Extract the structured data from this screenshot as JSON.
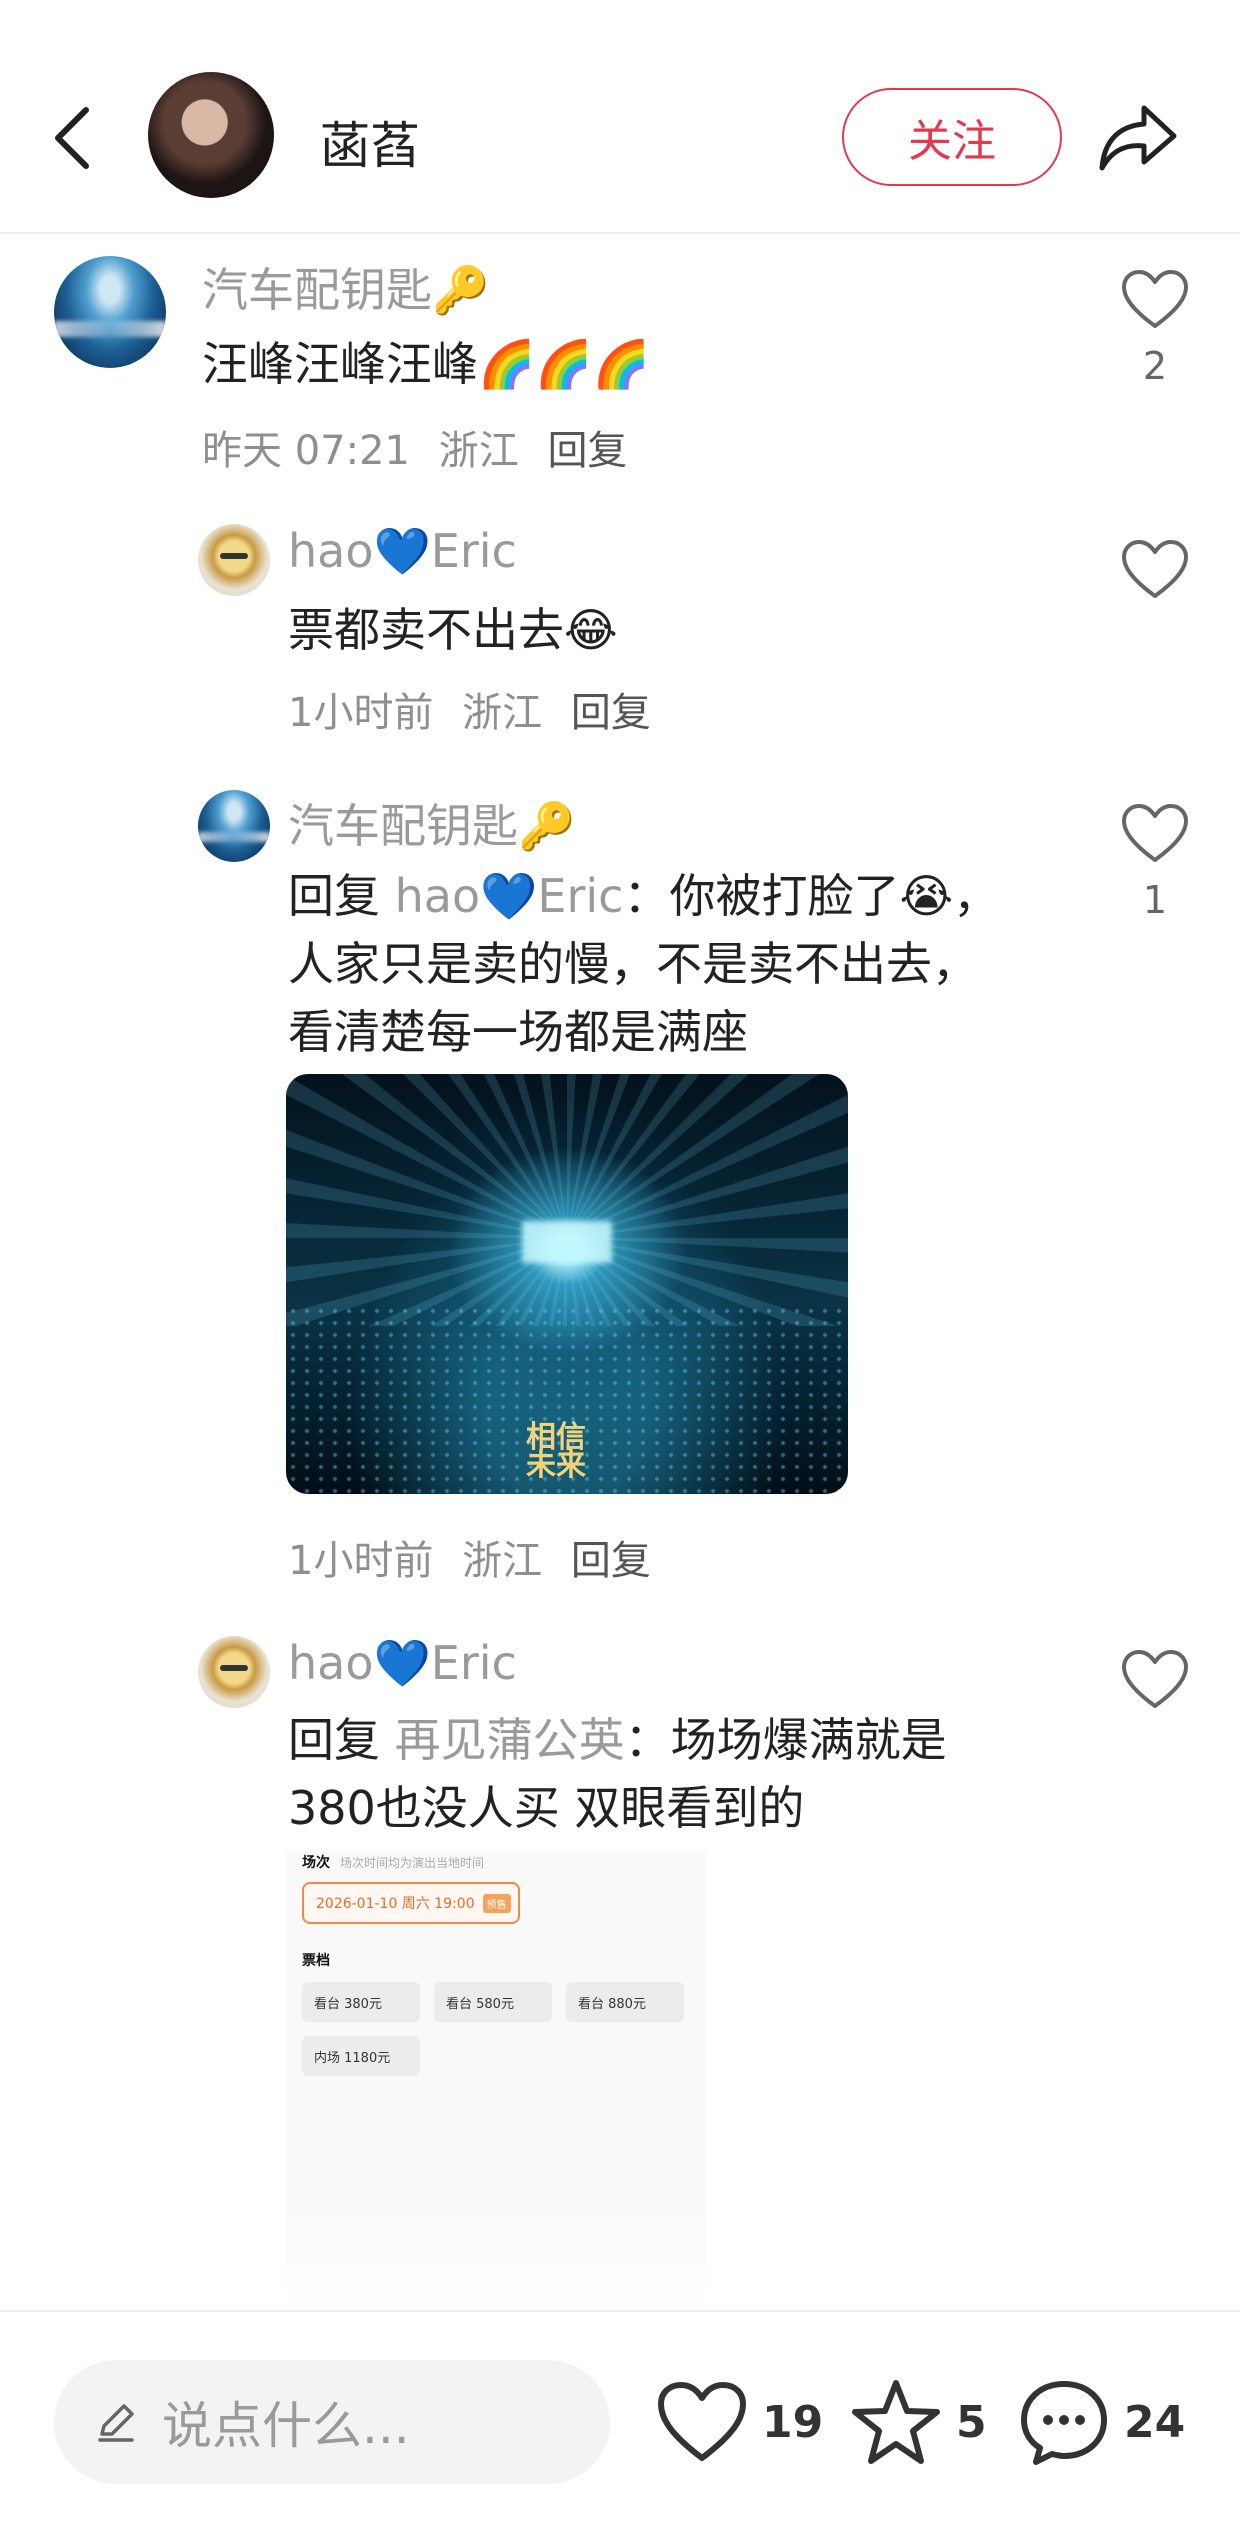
{
  "header": {
    "author_name": "菡萏",
    "follow_label": "关注"
  },
  "comments": [
    {
      "username": "汽车配钥匙🔑",
      "text": "汪峰汪峰汪峰🌈🌈🌈",
      "meta_time": "昨天 07:21",
      "meta_location": "浙江",
      "reply_label": "回复",
      "likes": "2"
    },
    {
      "username": "hao💙Eric",
      "text": "票都卖不出去😂",
      "meta_time": "1小时前",
      "meta_location": "浙江",
      "reply_label": "回复"
    },
    {
      "username": "汽车配钥匙🔑",
      "reply_prefix": "回复",
      "reply_target": "hao💙Eric",
      "line1": "：你被打脸了😭，",
      "line2": "人家只是卖的慢，不是卖不出去，",
      "line3": "看清楚每一场都是满座",
      "meta_time": "1小时前",
      "meta_location": "浙江",
      "reply_label": "回复",
      "likes": "1",
      "image_watermark": "相信未来"
    },
    {
      "username": "hao💙Eric",
      "reply_prefix": "回复",
      "reply_target": "再见蒲公英",
      "line1": "：场场爆满就是",
      "line2": "380也没人买 双眼看到的",
      "ticket": {
        "section_title": "场次",
        "section_sub": "场次时间均为演出当地时间",
        "date": "2026-01-10 周六 19:00",
        "date_tag": "预售",
        "price_title": "票档",
        "options": [
          "看台 380元",
          "看台 580元",
          "看台 880元",
          "内场 1180元"
        ]
      }
    }
  ],
  "bottom_bar": {
    "input_placeholder": "说点什么...",
    "like_count": "19",
    "star_count": "5",
    "comment_count": "24"
  },
  "colors": {
    "accent": "#e2394f",
    "muted_text": "#9a9a9a"
  }
}
